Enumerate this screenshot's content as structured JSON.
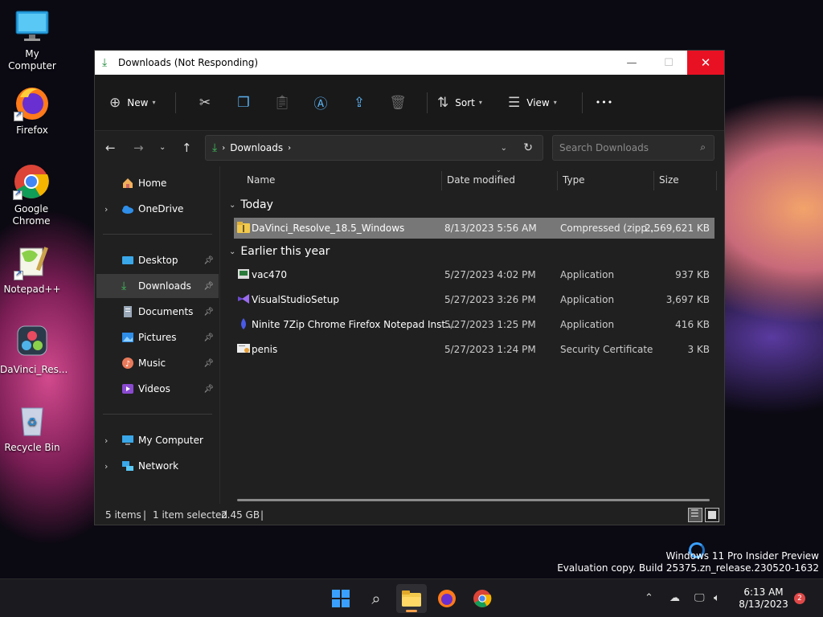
{
  "desktop": {
    "icons": [
      {
        "label": "My Computer",
        "icon": "monitor-icon"
      },
      {
        "label": "Firefox",
        "icon": "firefox-icon"
      },
      {
        "label": "Google Chrome",
        "icon": "chrome-icon"
      },
      {
        "label": "Notepad++",
        "icon": "notepadpp-icon"
      },
      {
        "label": "DaVinci_Res...",
        "icon": "davinci-icon"
      },
      {
        "label": "Recycle Bin",
        "icon": "recycle-bin-icon"
      }
    ]
  },
  "window": {
    "title": "Downloads (Not Responding)",
    "controls": {
      "minimize": "—",
      "maximize": "☐",
      "close": "✕"
    }
  },
  "toolbar": {
    "new_label": "New",
    "sort_label": "Sort",
    "view_label": "View",
    "more_label": "•••"
  },
  "address": {
    "crumb": "Downloads",
    "search_placeholder": "Search Downloads"
  },
  "nav": {
    "home": "Home",
    "onedrive": "OneDrive",
    "desktop": "Desktop",
    "downloads": "Downloads",
    "documents": "Documents",
    "pictures": "Pictures",
    "music": "Music",
    "videos": "Videos",
    "mycomputer": "My Computer",
    "network": "Network"
  },
  "columns": {
    "name": "Name",
    "date": "Date modified",
    "type": "Type",
    "size": "Size"
  },
  "groups": {
    "today": "Today",
    "earlier": "Earlier this year"
  },
  "files": [
    {
      "name": "DaVinci_Resolve_18.5_Windows",
      "date": "8/13/2023 5:56 AM",
      "type": "Compressed (zipp...",
      "size": "2,569,621 KB",
      "icon": "zip-folder-icon",
      "selected": true
    },
    {
      "name": "vac470",
      "date": "5/27/2023 4:02 PM",
      "type": "Application",
      "size": "937 KB",
      "icon": "app-icon"
    },
    {
      "name": "VisualStudioSetup",
      "date": "5/27/2023 3:26 PM",
      "type": "Application",
      "size": "3,697 KB",
      "icon": "visual-studio-icon"
    },
    {
      "name": "Ninite 7Zip Chrome Firefox Notepad Inst...",
      "date": "5/27/2023 1:25 PM",
      "type": "Application",
      "size": "416 KB",
      "icon": "ninite-icon"
    },
    {
      "name": "penis",
      "date": "5/27/2023 1:24 PM",
      "type": "Security Certificate",
      "size": "3 KB",
      "icon": "certificate-icon"
    }
  ],
  "status": {
    "items": "5 items",
    "selected": "1 item selected",
    "size": "2.45 GB",
    "sep": "|"
  },
  "watermark": {
    "line1": "Windows 11 Pro Insider Preview",
    "line2": "Evaluation copy. Build 25375.zn_release.230520-1632"
  },
  "taskbar": {
    "time": "6:13 AM",
    "date": "8/13/2023",
    "notification_count": "2"
  },
  "colors": {
    "accent": "#3aa0ff",
    "close_red": "#e81123",
    "selection": "#777777",
    "taskbar_indicator": "#f5a04b"
  }
}
